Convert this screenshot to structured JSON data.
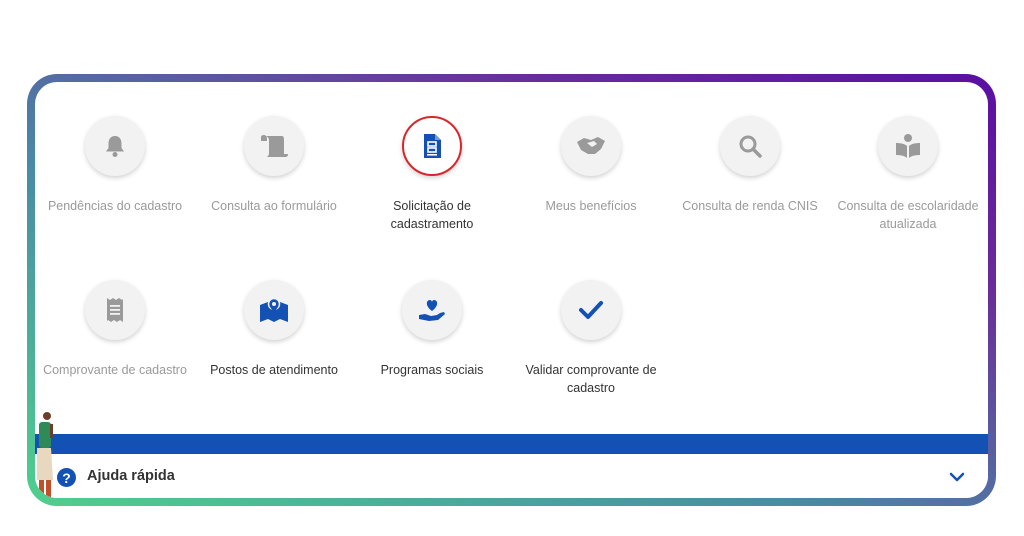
{
  "services": [
    {
      "label": "Pendências do cadastro",
      "icon": "bell-icon",
      "active": false,
      "muted": true
    },
    {
      "label": "Consulta ao formulário",
      "icon": "scroll-icon",
      "active": false,
      "muted": true
    },
    {
      "label": "Solicitação de cadastramento",
      "icon": "document-icon",
      "active": true,
      "muted": false
    },
    {
      "label": "Meus benefícios",
      "icon": "handshake-icon",
      "active": false,
      "muted": true
    },
    {
      "label": "Consulta de renda CNIS",
      "icon": "search-icon",
      "active": false,
      "muted": true
    },
    {
      "label": "Consulta de escolaridade atualizada",
      "icon": "book-reader-icon",
      "active": false,
      "muted": true
    },
    {
      "label": "Comprovante de cadastro",
      "icon": "receipt-icon",
      "active": false,
      "muted": true
    },
    {
      "label": "Postos de atendimento",
      "icon": "map-pin-icon",
      "active": false,
      "muted": false
    },
    {
      "label": "Programas sociais",
      "icon": "hand-heart-icon",
      "active": false,
      "muted": false
    },
    {
      "label": "Validar comprovante de cadastro",
      "icon": "check-icon",
      "active": false,
      "muted": false
    }
  ],
  "help": {
    "title": "Ajuda rápida",
    "icon": "question-circle-icon",
    "chevron": "chevron-down-icon"
  },
  "colors": {
    "brand_blue": "#1351b4",
    "muted_icon": "#9a9a9a",
    "active_ring": "#d9262b"
  }
}
